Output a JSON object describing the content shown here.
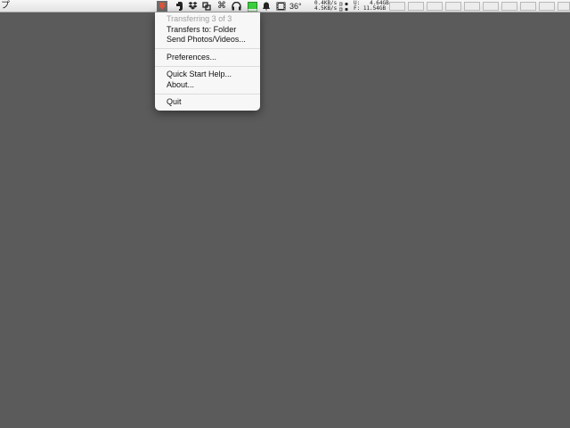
{
  "menubar": {
    "app_glyph": "プ",
    "temperature": "36°",
    "network": {
      "up": "0.4KB/s",
      "down": "4.5KB/s"
    },
    "disk": {
      "used": "U:   4.64GB",
      "free": "F: 11.54GB"
    },
    "icons": [
      "transfer-app-icon",
      "evernote-icon",
      "dropbox-icon",
      "screen-share-icon",
      "command-key-icon",
      "headphones-icon",
      "battery-icon",
      "notification-bell-icon",
      "film-icon"
    ],
    "active_color": "#6b6b6b",
    "transfer_icon_color": "#e0533a"
  },
  "menu": {
    "status": "Transferring 3 of 3",
    "transfers_to": "Transfers to: Folder",
    "send": "Send Photos/Videos...",
    "preferences": "Preferences...",
    "quick_start": "Quick Start Help...",
    "about": "About...",
    "quit": "Quit"
  }
}
